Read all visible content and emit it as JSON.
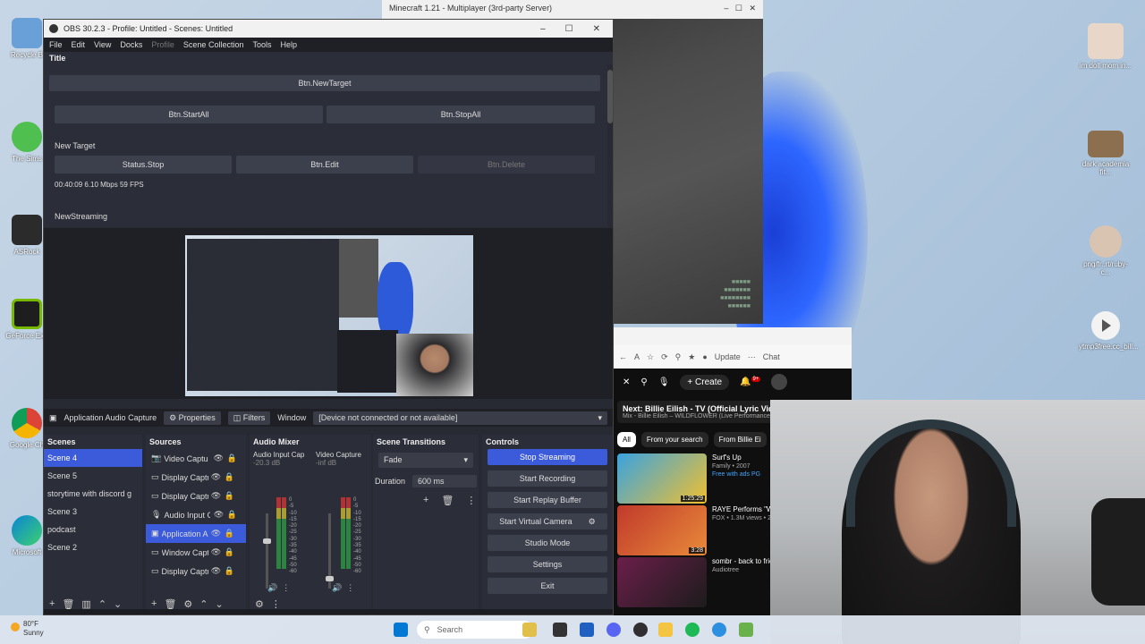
{
  "desktop": {
    "icons_left": [
      "Recycle B",
      "The Sims",
      "ASRock",
      "GeForce Exp",
      "Google Ch",
      "Microsoft"
    ],
    "icons_right": [
      "im doll mom in...",
      "dark academia fit...",
      "png/fr..rt/ruby-c...",
      "ytmp3free.cc_bill..."
    ]
  },
  "minecraft": {
    "title": "Minecraft 1.21 - Multiplayer (3rd-party Server)"
  },
  "browser": {
    "update_label": "Update",
    "chat_label": "Chat",
    "create_label": "Create",
    "notif_count": "9+",
    "next_title": "Next: Billie Eilish - TV (Official Lyric Video)",
    "next_sub": "Mix - Billie Eilish – WILDFLOWER (Live Performance",
    "chips": [
      "All",
      "From your search",
      "From Billie Ei"
    ],
    "videos": [
      {
        "title": "Surf's Up",
        "sub": "Family • 2007",
        "badge": "Free with ads  PG",
        "duration": "1:25:29"
      },
      {
        "title": "RAYE Performs \"W HUSBAND!\" | Live",
        "sub": "FOX  •  1.3M views • 2 week",
        "badge": "",
        "duration": "3:28"
      },
      {
        "title": "sombr - back to friends Live",
        "sub": "Audiotree",
        "badge": "",
        "duration": ""
      }
    ]
  },
  "taskbar": {
    "temp": "80°F",
    "condition": "Sunny",
    "search_placeholder": "Search"
  },
  "obs": {
    "title": "OBS 30.2.3 - Profile: Untitled - Scenes: Untitled",
    "menu": [
      "File",
      "Edit",
      "View",
      "Docks",
      "Profile",
      "Scene Collection",
      "Tools",
      "Help"
    ],
    "dock_title": "Title",
    "btn_new_target": "Btn.NewTarget",
    "btn_start_all": "Btn.StartAll",
    "btn_stop_all": "Btn.StopAll",
    "new_target": "New Target",
    "status_stop": "Status.Stop",
    "btn_edit": "Btn.Edit",
    "btn_delete": "Btn.Delete",
    "stats": "00:40:09  6.10 Mbps  59 FPS",
    "new_streaming": "NewStreaming",
    "context": {
      "source_name": "Application Audio Capture",
      "properties": "Properties",
      "filters": "Filters",
      "window_label": "Window",
      "window_value": "[Device not connected or not available]"
    },
    "scenes": {
      "title": "Scenes",
      "items": [
        "Scene 4",
        "Scene 5",
        "storytime with discord g",
        "Scene 3",
        "podcast",
        "Scene 2"
      ]
    },
    "sources": {
      "title": "Sources",
      "items": [
        "Video Captu",
        "Display Captu",
        "Display Captu",
        "Audio Input C",
        "Application A",
        "Window Capt",
        "Display Captu"
      ]
    },
    "mixer": {
      "title": "Audio Mixer",
      "channels": [
        {
          "name": "Audio Input Cap",
          "db": "-20.3 dB"
        },
        {
          "name": "Video Capture",
          "db": "-inf dB"
        }
      ],
      "scale": [
        "0",
        "-5",
        "-10",
        "-15",
        "-20",
        "-25",
        "-30",
        "-35",
        "-40",
        "-45",
        "-50",
        "-60"
      ]
    },
    "transitions": {
      "title": "Scene Transitions",
      "type": "Fade",
      "duration_label": "Duration",
      "duration_value": "600 ms"
    },
    "controls": {
      "title": "Controls",
      "stop_streaming": "Stop Streaming",
      "start_recording": "Start Recording",
      "start_replay": "Start Replay Buffer",
      "start_virtual": "Start Virtual Camera",
      "studio_mode": "Studio Mode",
      "settings": "Settings",
      "exit": "Exit"
    }
  },
  "colors": {
    "accent": "#3b5bdb",
    "obs_bg": "#272a33"
  }
}
